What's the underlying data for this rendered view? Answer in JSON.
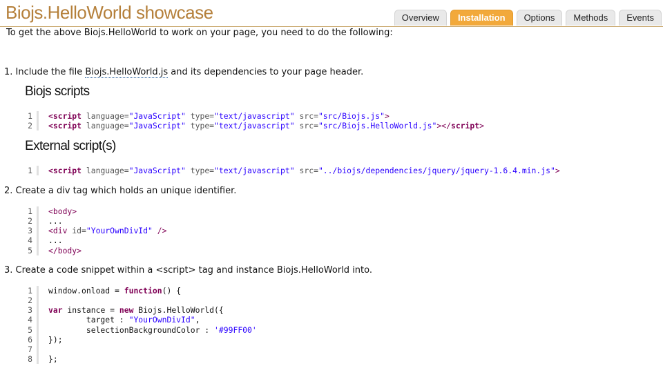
{
  "header": {
    "title": "Biojs.HelloWorld showcase",
    "tabs": [
      {
        "label": "Overview",
        "active": false
      },
      {
        "label": "Installation",
        "active": true
      },
      {
        "label": "Options",
        "active": false
      },
      {
        "label": "Methods",
        "active": false
      },
      {
        "label": "Events",
        "active": false
      }
    ]
  },
  "intro": "To get the above Biojs.HelloWorld to work on your page, you need to do the following:",
  "step1": {
    "prefix": "1. Include the file ",
    "link": "Biojs.HelloWorld.js",
    "suffix": " and its dependencies to your page header."
  },
  "biojs_scripts": {
    "heading": "Biojs scripts",
    "line_numbers": [
      "1",
      "2"
    ],
    "tokens": [
      [
        "<script",
        " language=",
        "\"JavaScript\"",
        " type=",
        "\"text/javascript\"",
        " src=",
        "\"src/Biojs.js\"",
        ">"
      ],
      [
        "<script",
        " language=",
        "\"JavaScript\"",
        " type=",
        "\"text/javascript\"",
        " src=",
        "\"src/Biojs.HelloWorld.js\"",
        "></",
        "script",
        ">"
      ]
    ]
  },
  "external_scripts": {
    "heading": "External script(s)",
    "line_numbers": [
      "1"
    ],
    "tokens": [
      [
        "<script",
        " language=",
        "\"JavaScript\"",
        " type=",
        "\"text/javascript\"",
        " src=",
        "\"../biojs/dependencies/jquery/jquery-1.6.4.min.js\"",
        ">"
      ]
    ]
  },
  "step2": "2. Create a div tag which holds an unique identifier.",
  "div_code": {
    "line_numbers": [
      "1",
      "2",
      "3",
      "4",
      "5"
    ],
    "tokens": [
      [
        "<body>"
      ],
      [
        "..."
      ],
      [
        "<div",
        " id=",
        "\"YourOwnDivId\"",
        " />"
      ],
      [
        "..."
      ],
      [
        "</body>"
      ]
    ]
  },
  "step3": "3. Create a code snippet within a <script> tag and instance Biojs.HelloWorld into.",
  "js_code": {
    "line_numbers": [
      "1",
      "2",
      "3",
      "4",
      "5",
      "6",
      "7",
      "8"
    ],
    "tokens": [
      [
        "window.onload = ",
        "function",
        "() {"
      ],
      [
        ""
      ],
      [
        "var",
        " instance = ",
        "new",
        " Biojs.HelloWorld({"
      ],
      [
        "        target : ",
        "\"YourOwnDivId\"",
        ","
      ],
      [
        "        selectionBackgroundColor : ",
        "'#99FF00'"
      ],
      [
        "});"
      ],
      [
        ""
      ],
      [
        "};"
      ]
    ]
  },
  "colors": {
    "title": "#b5803b",
    "active_tab": "#f2a93b",
    "keyword": "#7f0055",
    "string": "#2a00ff"
  }
}
